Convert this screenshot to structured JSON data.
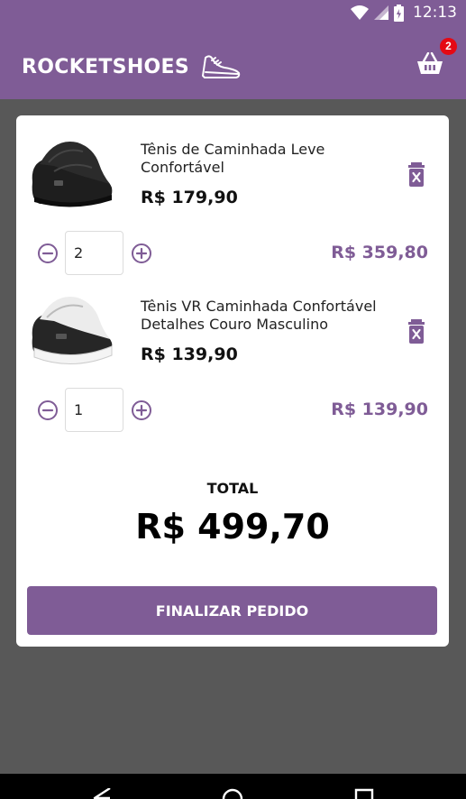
{
  "status_bar": {
    "time": "12:13"
  },
  "header": {
    "brand": "ROCKETSHOES",
    "cart_count": "2"
  },
  "cart": {
    "items": [
      {
        "title": "Tênis de Caminhada Leve Confortável",
        "price": "R$ 179,90",
        "quantity": "2",
        "subtotal": "R$ 359,80"
      },
      {
        "title": "Tênis VR Caminhada Confortável Detalhes Couro Masculino",
        "price": "R$ 139,90",
        "quantity": "1",
        "subtotal": "R$ 139,90"
      }
    ],
    "total_label": "TOTAL",
    "total_value": "R$ 499,70",
    "checkout_label": "FINALIZAR PEDIDO"
  },
  "colors": {
    "primary": "#7f5c96",
    "badge": "#e50914",
    "background": "#585858"
  }
}
